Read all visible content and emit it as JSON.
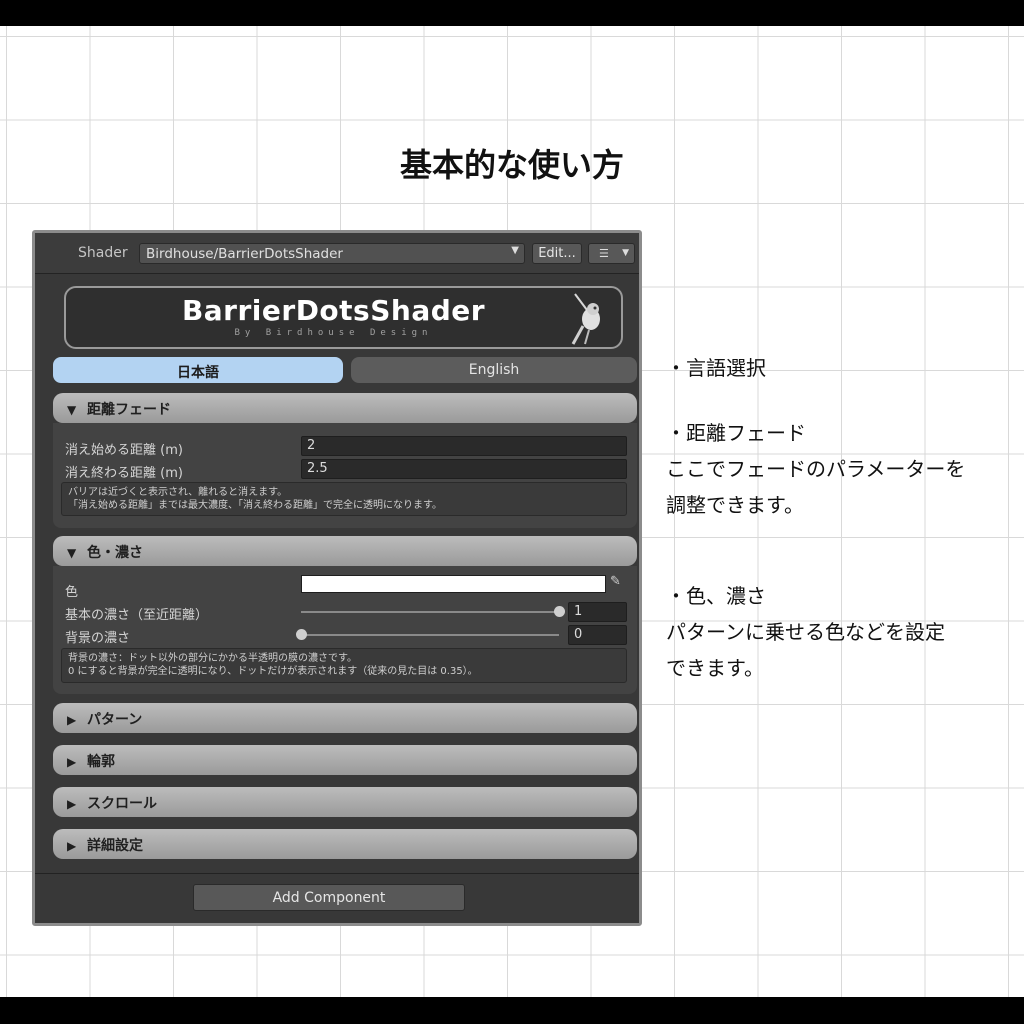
{
  "page_title": "基本的な使い方",
  "inspector": {
    "shader_label": "Shader",
    "shader_value": "Birdhouse/BarrierDotsShader",
    "edit_button": "Edit...",
    "menu_icon": "list-menu-icon",
    "banner": {
      "title": "BarrierDotsShader",
      "subtitle": "By Birdhouse Design",
      "icon": "bird-logo-icon"
    },
    "tabs": [
      {
        "label": "日本語",
        "selected": true
      },
      {
        "label": "English",
        "selected": false
      }
    ],
    "sections": {
      "distance_fade": {
        "title": "距離フェード",
        "expanded": true,
        "fields": [
          {
            "label": "消え始める距離 (m)",
            "value": "2"
          },
          {
            "label": "消え終わる距離 (m)",
            "value": "2.5"
          }
        ],
        "help": [
          "バリアは近づくと表示され、離れると消えます。",
          "「消え始める距離」までは最大濃度、「消え終わる距離」で完全に透明になります。"
        ]
      },
      "color_density": {
        "title": "色・濃さ",
        "expanded": true,
        "color_label": "色",
        "color_value": "#ffffff",
        "sliders": [
          {
            "label": "基本の濃さ（至近距離）",
            "value": "1",
            "fraction": 1
          },
          {
            "label": "背景の濃さ",
            "value": "0",
            "fraction": 0
          }
        ],
        "help": [
          "背景の濃さ：ドット以外の部分にかかる半透明の膜の濃さです。",
          "0 にすると背景が完全に透明になり、ドットだけが表示されます（従来の見た目は 0.35）。"
        ]
      },
      "collapsed": [
        {
          "title": "パターン"
        },
        {
          "title": "輪郭"
        },
        {
          "title": "スクロール"
        },
        {
          "title": "詳細設定"
        }
      ]
    },
    "add_component": "Add Component"
  },
  "notes": {
    "language": "・言語選択",
    "fade_title": "・距離フェード",
    "fade_line1": "ここでフェードのパラメーターを",
    "fade_line2": "調整できます。",
    "color_title": "・色、濃さ",
    "color_line1": "パターンに乗せる色などを設定",
    "color_line2": "できます。"
  },
  "colors": {
    "tab_selected": "#b3d3f2",
    "panel_bg": "#383838",
    "section_header": "#bcbcbc"
  }
}
